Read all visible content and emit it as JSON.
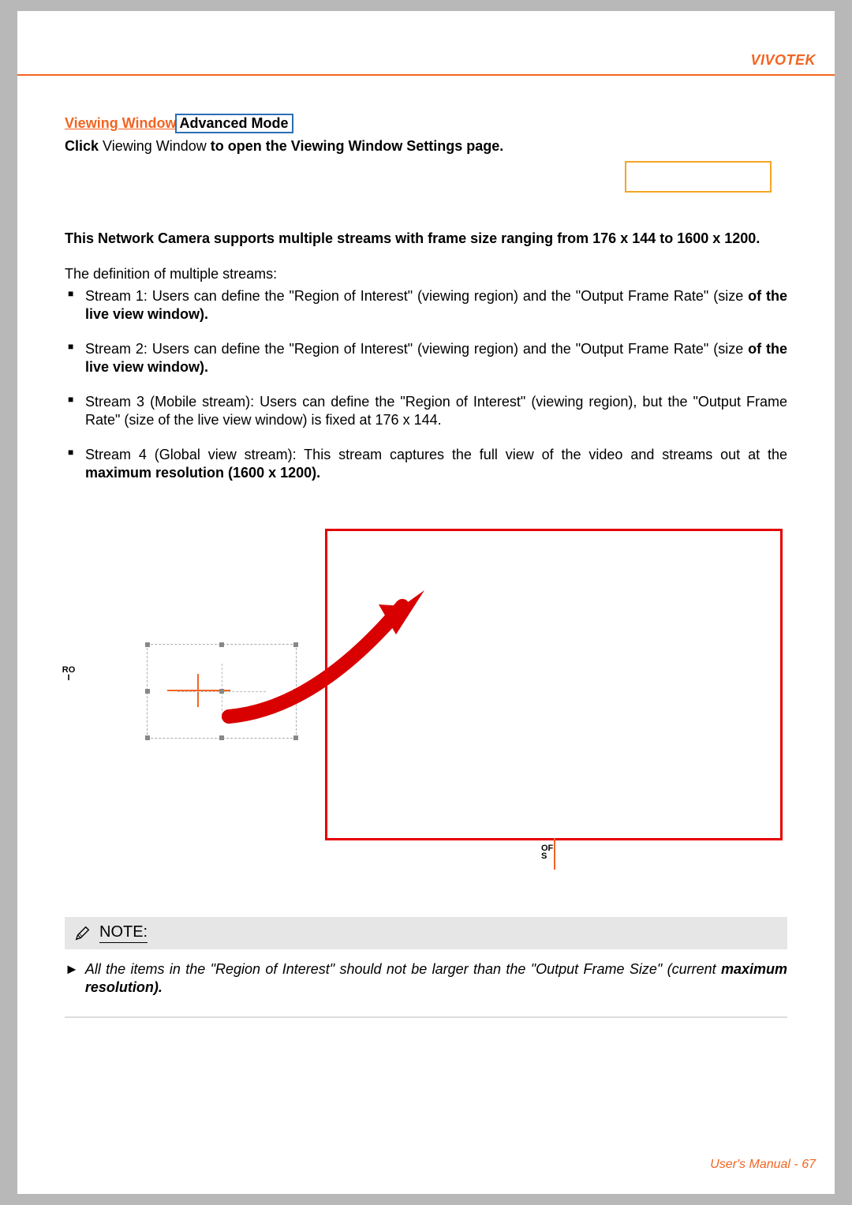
{
  "brand": "VIVOTEK",
  "section": {
    "link_label": "Viewing Window",
    "advanced_badge": "Advanced Mode",
    "click_prefix": "Click",
    "click_mid": "Viewing Window",
    "click_suffix": "to open the Viewing Window Settings page."
  },
  "intro": "This Network Camera supports multiple streams with frame size ranging from 176 x 144 to 1600 x 1200.",
  "definition_lead": "The definition of multiple streams:",
  "streams": [
    {
      "plain": "Stream 1: Users can define the \"Region of Interest\" (viewing region) and the \"Output Frame Rate\" (size ",
      "bold": "of the live view window)."
    },
    {
      "plain": "Stream 2: Users can define the \"Region of Interest\" (viewing region) and the \"Output Frame Rate\" (size ",
      "bold": "of the live view window)."
    },
    {
      "plain": "Stream 3 (Mobile stream): Users can define the \"Region of Interest\" (viewing region), but the \"Output Frame Rate\" (size of the live view window) is fixed at 176 x 144.",
      "bold": ""
    },
    {
      "plain": "Stream 4 (Global view stream): This stream captures the full view of the video and streams out at the ",
      "bold": "maximum resolution (1600 x 1200)."
    }
  ],
  "diagram": {
    "roi_label": "ROI",
    "ofs_label": "OFS"
  },
  "note": {
    "title": "NOTE:",
    "body_plain": "All the items in the \"Region of Interest\" should not be larger than the \"Output Frame Size\" (current ",
    "body_bold": "maximum resolution)."
  },
  "footer": "User's Manual - 67"
}
